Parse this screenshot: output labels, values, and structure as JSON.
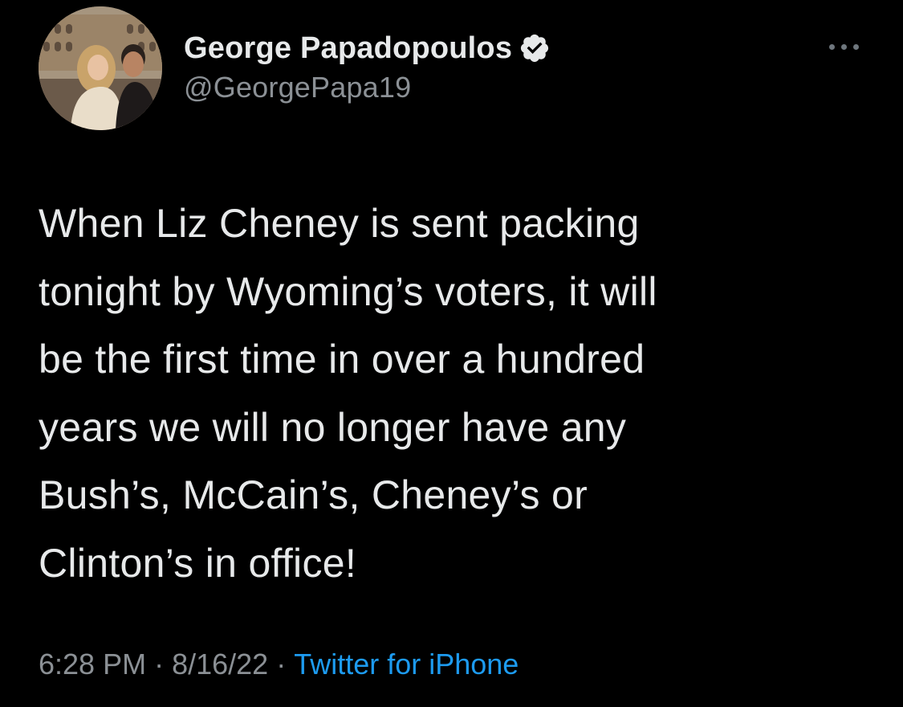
{
  "author": {
    "display_name": "George Papadopoulos",
    "handle": "@GeorgePapa19",
    "verified": true,
    "avatar_icon": "profile-photo"
  },
  "tweet": {
    "text": "When Liz Cheney is sent packing\ntonight by Wyoming’s voters, it will\nbe the first time in over a hundred\nyears we will no longer have any\nBush’s, McCain’s, Cheney’s or\nClinton’s in office!",
    "time": "6:28 PM",
    "date": "8/16/22",
    "separator": "·",
    "source": "Twitter for iPhone"
  },
  "colors": {
    "background": "#000000",
    "text": "#e7e9ea",
    "secondary_text": "#8b9095",
    "link": "#1d9bf0"
  },
  "icons": {
    "verified": "verified-badge-icon",
    "more": "more-options-icon"
  }
}
